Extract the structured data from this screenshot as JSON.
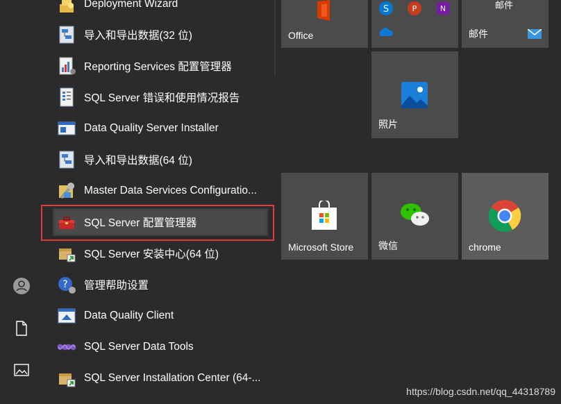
{
  "apps": [
    {
      "label": "Deployment Wizard",
      "icon": "deployment-wizard-icon"
    },
    {
      "label": "导入和导出数据(32 位)",
      "icon": "import-export-icon"
    },
    {
      "label": "Reporting Services 配置管理器",
      "icon": "reporting-services-icon"
    },
    {
      "label": "SQL Server 错误和使用情况报告",
      "icon": "error-report-icon"
    },
    {
      "label": "Data Quality Server Installer",
      "icon": "dq-installer-icon"
    },
    {
      "label": "导入和导出数据(64 位)",
      "icon": "import-export-icon"
    },
    {
      "label": "Master Data Services Configuratio...",
      "icon": "master-data-icon"
    },
    {
      "label": "SQL Server 配置管理器",
      "icon": "toolbox-icon"
    },
    {
      "label": "SQL Server 安装中心(64 位)",
      "icon": "install-center-icon"
    },
    {
      "label": "管理帮助设置",
      "icon": "help-settings-icon"
    },
    {
      "label": "Data Quality Client",
      "icon": "dq-client-icon"
    },
    {
      "label": "SQL Server Data Tools",
      "icon": "data-tools-icon"
    },
    {
      "label": "SQL Server Installation Center (64-...",
      "icon": "install-center-icon"
    }
  ],
  "tiles": {
    "office": {
      "label": "Office"
    },
    "small_apps": {
      "label": ""
    },
    "mail": {
      "label": "邮件",
      "top_label": "邮件"
    },
    "photos": {
      "label": "照片"
    },
    "store": {
      "label": "Microsoft Store"
    },
    "wechat": {
      "label": "微信"
    },
    "chrome": {
      "label": "chrome"
    }
  },
  "rail": [
    "user-icon",
    "document-icon",
    "pictures-icon"
  ],
  "watermark": "https://blog.csdn.net/qq_44318789",
  "colors": {
    "background": "#2b2b2b",
    "tile": "#4b4b4b",
    "highlight": "#e03c3c"
  }
}
